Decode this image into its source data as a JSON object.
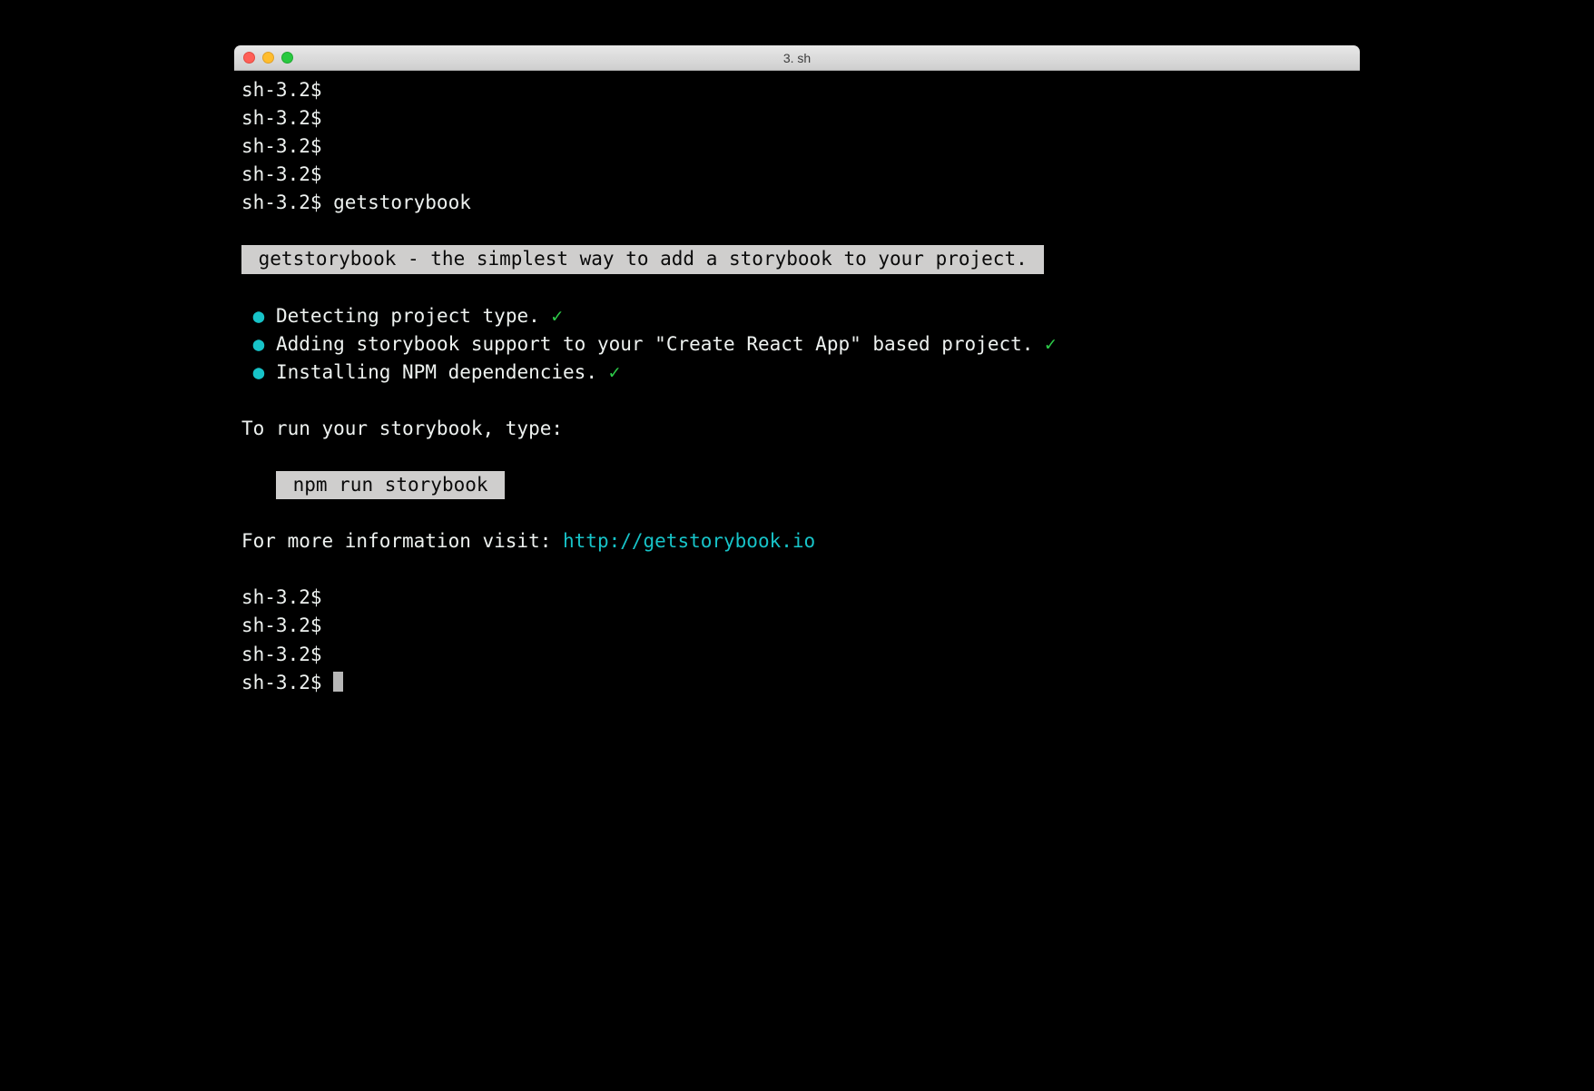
{
  "window": {
    "title": "3. sh"
  },
  "prompt": "sh-3.2$",
  "lines_before": [
    "",
    "",
    "",
    ""
  ],
  "command": "getstorybook",
  "banner": " getstorybook - the simplest way to add a storybook to your project. ",
  "steps": [
    "Detecting project type.",
    "Adding storybook support to your \"Create React App\" based project.",
    "Installing NPM dependencies."
  ],
  "run_msg": "To run your storybook, type:",
  "run_cmd": " npm run storybook ",
  "info_prefix": "For more information visit: ",
  "info_url": "http://getstorybook.io",
  "lines_after": [
    "",
    "",
    ""
  ],
  "glyphs": {
    "bullet": "●",
    "check": "✓"
  }
}
